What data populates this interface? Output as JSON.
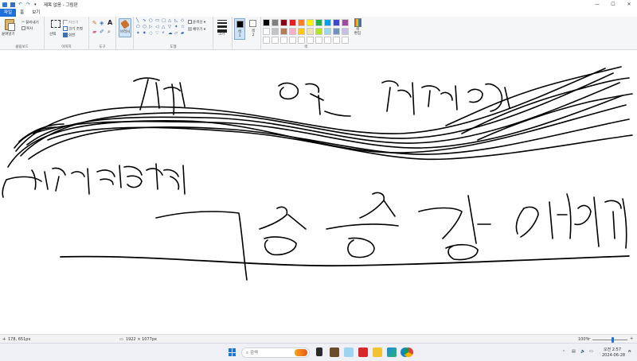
{
  "window": {
    "title": "제목 없음 - 그림판",
    "controls": [
      "—",
      "☐",
      "✕"
    ]
  },
  "tabs": [
    {
      "label": "파일",
      "active": true
    },
    {
      "label": "홈",
      "active": false
    },
    {
      "label": "보기",
      "active": false
    }
  ],
  "ribbon": {
    "clipboard": {
      "paste": "붙여넣기",
      "cut": "잘라내기",
      "copy": "복사",
      "group": "클립보드"
    },
    "image": {
      "select": "선택",
      "crop": "자르기",
      "resize": "크기 조정",
      "rotate": "회전",
      "group": "이미지"
    },
    "tools": {
      "group": "도구",
      "icons": [
        "pencil-icon",
        "fill-icon",
        "text-icon",
        "eraser-icon",
        "color-picker-icon",
        "magnifier-icon"
      ]
    },
    "brushes": {
      "label": "브러시"
    },
    "shapes": {
      "outline": "윤곽선",
      "fill": "채우기",
      "group": "도형",
      "glyphs": [
        "╲",
        "∿",
        "○",
        "▭",
        "▢",
        "△",
        "◺",
        "◇",
        "⬠",
        "⬡",
        "▷",
        "◁",
        "△",
        "▽",
        "✦",
        "☆",
        "✶",
        "✷",
        "◌",
        "♡",
        "⚡",
        "☁",
        "▱",
        "▰"
      ]
    },
    "size": {
      "label": "크기"
    },
    "colors": {
      "color1": "색\n1",
      "color2": "색\n2",
      "edit": "색\n편집",
      "group": "색",
      "color1_value": "#000000",
      "color2_value": "#ffffff",
      "palette": [
        "#000000",
        "#7f7f7f",
        "#880015",
        "#ed1c24",
        "#ff7f27",
        "#fff200",
        "#22b14c",
        "#00a2e8",
        "#3f48cc",
        "#a349a4",
        "#ffffff",
        "#c3c3c3",
        "#b97a57",
        "#ffaec9",
        "#ffc90e",
        "#efe4b0",
        "#b5e61d",
        "#99d9ea",
        "#7092be",
        "#c8bfe7",
        "#ffffff",
        "#ffffff",
        "#ffffff",
        "#ffffff",
        "#ffffff",
        "#ffffff",
        "#ffffff",
        "#ffffff",
        "#ffffff",
        "#ffffff"
      ]
    }
  },
  "status": {
    "cursor": "178, 651px",
    "dimensions": "1922 × 1077px",
    "zoom": "100%"
  },
  "taskbar": {
    "search_placeholder": "검색",
    "time": "오전 2:57",
    "date": "2024-06-28"
  }
}
